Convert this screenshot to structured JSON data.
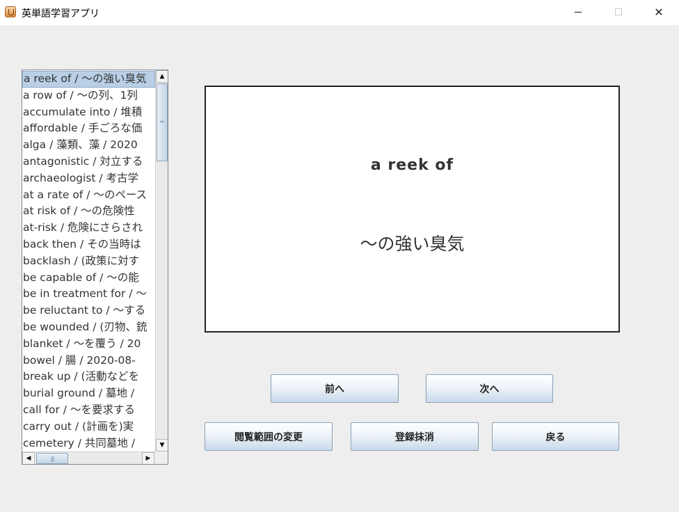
{
  "window": {
    "title": "英単語学習アプリ",
    "minimize": "",
    "maximize": "",
    "close": "✕"
  },
  "word_list": {
    "items": [
      "a reek of / 〜の強い臭気",
      "a row of / 〜の列、1列",
      "accumulate into / 堆積",
      "affordable / 手ごろな価",
      "alga / 藻類、藻 / 2020",
      "antagonistic / 対立する",
      "archaeologist / 考古学",
      "at a rate of / 〜のペース",
      "at risk of / 〜の危険性",
      "at-risk / 危険にさらされ",
      "back then / その当時は",
      "backlash / (政策に対す",
      "be capable of / 〜の能",
      "be in treatment for / 〜",
      "be reluctant to / 〜する",
      "be wounded / (刃物、銃",
      "blanket / 〜を覆う / 20",
      "bowel / 腸 / 2020-08-",
      "break up / (活動などを",
      "burial ground / 墓地 /",
      "call for / 〜を要求する",
      "carry out / (計画を)実",
      "cemetery / 共同墓地 /"
    ],
    "selected_index": 0
  },
  "scrollbars": {
    "up_arrow": "▲",
    "down_arrow": "▼",
    "left_arrow": "◀",
    "right_arrow": "▶",
    "v_grip": "═",
    "h_grip": "|||"
  },
  "card": {
    "word": "a reek of",
    "meaning": "〜の強い臭気"
  },
  "buttons": {
    "prev": "前へ",
    "next": "次へ",
    "change_range": "閲覧範囲の変更",
    "delete": "登録抹消",
    "back": "戻る"
  }
}
